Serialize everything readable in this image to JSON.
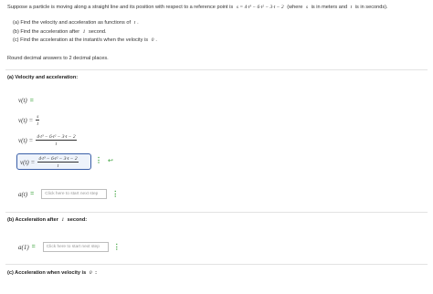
{
  "problem": {
    "intro": "Suppose a particle is moving along a straight line and its position with respect to a reference point is",
    "position_eq": "s = 4·t³ − 6·t² − 3·t − 2",
    "where_prefix": "(where",
    "where_s_var": "s",
    "where_middle": "is in meters and",
    "where_t_var": "t",
    "where_suffix": "is in seconds).",
    "part_a_text": "(a) Find the velocity and acceleration as functions of",
    "part_a_var": "t",
    "part_a_end": ".",
    "part_b_text": "(b) Find the acceleration after",
    "part_b_num": "1",
    "part_b_end": "second.",
    "part_c_text": "(c) Find the acceleration at the instant/s when the velocity is",
    "part_c_num": "0",
    "part_c_end": ".",
    "round_text": "Round decimal answers to 2 decimal places."
  },
  "section_a": {
    "title": "(a) Velocity and acceleration:",
    "steps": [
      {
        "lhs": "v(t)",
        "eq": "="
      },
      {
        "lhs": "v(t) =",
        "num": "s",
        "den": "t"
      },
      {
        "lhs": "v(t) =",
        "num": "4·t³ − 6·t² − 3·t − 2",
        "den": "t"
      },
      {
        "lhs": "v(t) =",
        "num": "4·t³ − 6·t² − 3·t − 2",
        "den": "t"
      }
    ],
    "acc_lhs": "a(t)",
    "acc_eq": "=",
    "acc_placeholder": "Click here to start next step"
  },
  "section_b": {
    "title_prefix": "(b) Acceleration after",
    "title_num": "1",
    "title_suffix": "second:",
    "lhs": "a(1)",
    "eq": "=",
    "placeholder": "Click here to start next step"
  },
  "section_c": {
    "title_prefix": "(c) Acceleration when velocity is",
    "title_num": "0",
    "title_suffix": ":"
  },
  "icons": {
    "menu": "⋮",
    "back": "↩"
  },
  "colors": {
    "accent_green": "#3aa13a",
    "highlight_border": "#3a5fa8"
  }
}
